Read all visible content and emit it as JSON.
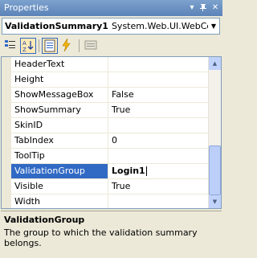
{
  "window": {
    "title": "Properties"
  },
  "object_selector": {
    "name": "ValidationSummary1",
    "type": "System.Web.UI.WebControls.ValidationSummary"
  },
  "toolbar": {
    "categorized_icon": "categorized-icon",
    "alphabetical_icon": "alphabetical-icon",
    "properties_icon": "properties-icon",
    "events_icon": "events-icon",
    "property_pages_icon": "property-pages-icon"
  },
  "properties": [
    {
      "name": "HeaderText",
      "value": ""
    },
    {
      "name": "Height",
      "value": ""
    },
    {
      "name": "ShowMessageBox",
      "value": "False"
    },
    {
      "name": "ShowSummary",
      "value": "True"
    },
    {
      "name": "SkinID",
      "value": ""
    },
    {
      "name": "TabIndex",
      "value": "0"
    },
    {
      "name": "ToolTip",
      "value": ""
    },
    {
      "name": "ValidationGroup",
      "value": "Login1"
    },
    {
      "name": "Visible",
      "value": "True"
    },
    {
      "name": "Width",
      "value": ""
    }
  ],
  "description": {
    "title": "ValidationGroup",
    "text": "The group to which the validation summary belongs."
  },
  "colors": {
    "title_bar": "#6A91C5",
    "selection": "#316AC5",
    "chrome": "#ECE9D8"
  }
}
